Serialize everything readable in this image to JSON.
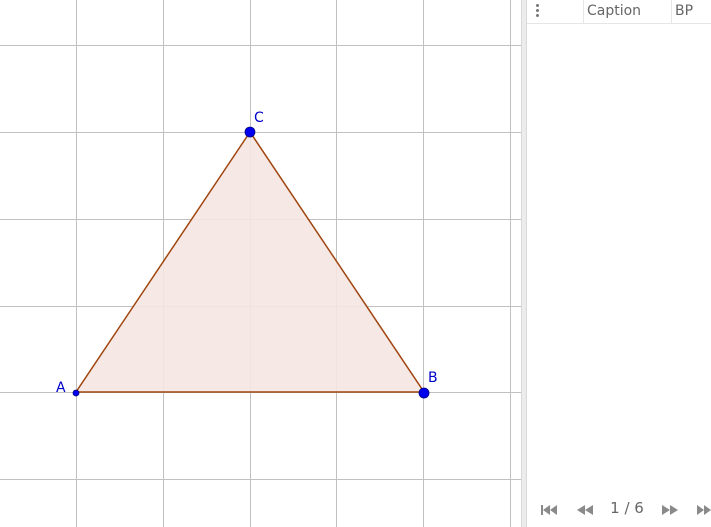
{
  "graphics": {
    "colors": {
      "grid": "#c0c0c0",
      "polygon_fill": "#f5e6e1",
      "polygon_stroke": "#a0450f",
      "point": "#0000ee",
      "label": "#0000cc"
    },
    "points": {
      "A": {
        "label": "A"
      },
      "B": {
        "label": "B"
      },
      "C": {
        "label": "C"
      }
    }
  },
  "construction_protocol": {
    "columns": {
      "caption": "Caption",
      "bp": "BP"
    },
    "navigation": {
      "counter": "1 / 6",
      "current_step": 1,
      "total_steps": 6
    }
  }
}
